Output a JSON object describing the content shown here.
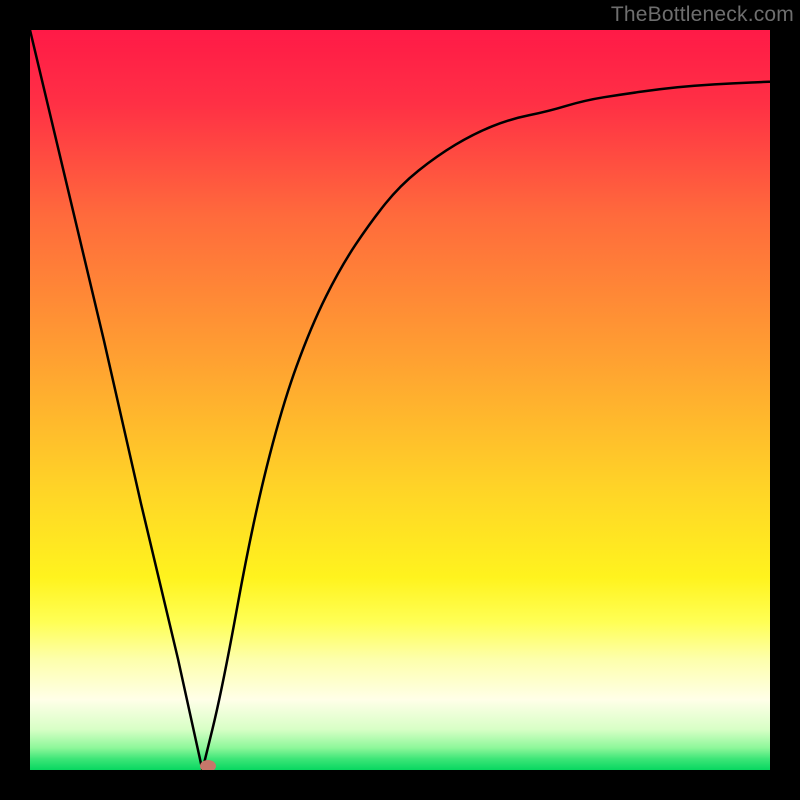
{
  "watermark": {
    "text": "TheBottleneck.com"
  },
  "chart_data": {
    "type": "line",
    "title": "",
    "xlabel": "",
    "ylabel": "",
    "xlim": [
      0,
      1
    ],
    "ylim": [
      0,
      1
    ],
    "gradient_stops": [
      {
        "offset": 0.0,
        "color": "#ff1a47"
      },
      {
        "offset": 0.1,
        "color": "#ff3045"
      },
      {
        "offset": 0.25,
        "color": "#ff6a3c"
      },
      {
        "offset": 0.45,
        "color": "#ffa231"
      },
      {
        "offset": 0.62,
        "color": "#ffd427"
      },
      {
        "offset": 0.74,
        "color": "#fff31e"
      },
      {
        "offset": 0.8,
        "color": "#ffff55"
      },
      {
        "offset": 0.85,
        "color": "#fdffab"
      },
      {
        "offset": 0.905,
        "color": "#ffffe8"
      },
      {
        "offset": 0.945,
        "color": "#d8ffc6"
      },
      {
        "offset": 0.97,
        "color": "#8ef79a"
      },
      {
        "offset": 0.985,
        "color": "#3de678"
      },
      {
        "offset": 1.0,
        "color": "#08d760"
      }
    ],
    "series": [
      {
        "name": "bottleneck-curve",
        "x": [
          0.0,
          0.05,
          0.1,
          0.15,
          0.2,
          0.233,
          0.26,
          0.3,
          0.34,
          0.38,
          0.42,
          0.46,
          0.5,
          0.55,
          0.6,
          0.65,
          0.7,
          0.75,
          0.8,
          0.85,
          0.9,
          0.95,
          1.0
        ],
        "y": [
          1.0,
          0.79,
          0.58,
          0.36,
          0.15,
          0.0,
          0.11,
          0.33,
          0.49,
          0.6,
          0.68,
          0.74,
          0.79,
          0.83,
          0.86,
          0.88,
          0.89,
          0.905,
          0.913,
          0.92,
          0.925,
          0.928,
          0.93
        ]
      }
    ],
    "marker": {
      "x": 0.24,
      "y": 0.005,
      "color": "#c7776a"
    }
  }
}
